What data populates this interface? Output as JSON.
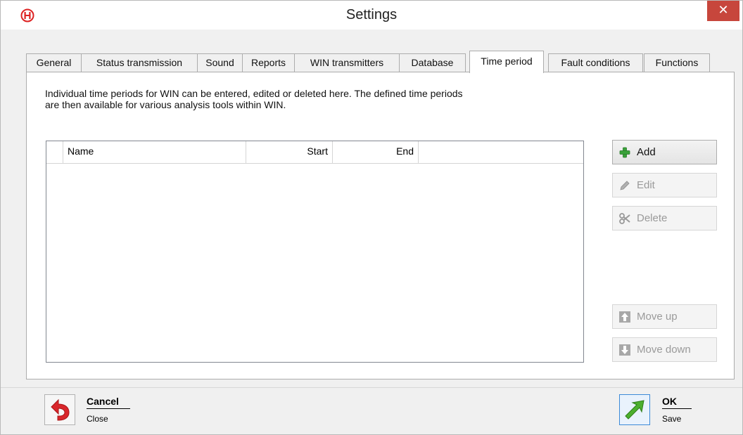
{
  "window": {
    "title": "Settings",
    "close_symbol": "✕"
  },
  "tabs": [
    {
      "label": "General"
    },
    {
      "label": "Status transmission"
    },
    {
      "label": "Sound"
    },
    {
      "label": "Reports"
    },
    {
      "label": "WIN transmitters"
    },
    {
      "label": "Database"
    },
    {
      "label": "Time period",
      "active": true
    },
    {
      "label": "Fault conditions"
    },
    {
      "label": "Functions"
    }
  ],
  "description": {
    "line1": "Individual time periods for WIN can be entered, edited or deleted here. The defined time periods",
    "line2": "are then available for various analysis tools within WIN."
  },
  "grid": {
    "columns": [
      "Name",
      "Start",
      "End"
    ],
    "rows": []
  },
  "buttons": {
    "add": "Add",
    "edit": "Edit",
    "delete": "Delete",
    "move_up": "Move up",
    "move_down": "Move down"
  },
  "footer": {
    "cancel_title": "Cancel",
    "cancel_sub": "Close",
    "ok_title": "OK",
    "ok_sub": "Save"
  },
  "colors": {
    "close_button": "#c7463c",
    "add_icon": "#3aa23a",
    "cancel_icon": "#d9262b",
    "ok_icon": "#4caf2e",
    "ok_border": "#3c8ad8"
  },
  "icons": {
    "app": "app-logo-icon",
    "add": "plus-icon",
    "edit": "pencil-icon",
    "delete": "scissors-icon",
    "move_up": "arrow-up-icon",
    "move_down": "arrow-down-icon",
    "cancel": "undo-arrow-icon",
    "ok": "diagonal-arrow-icon"
  }
}
